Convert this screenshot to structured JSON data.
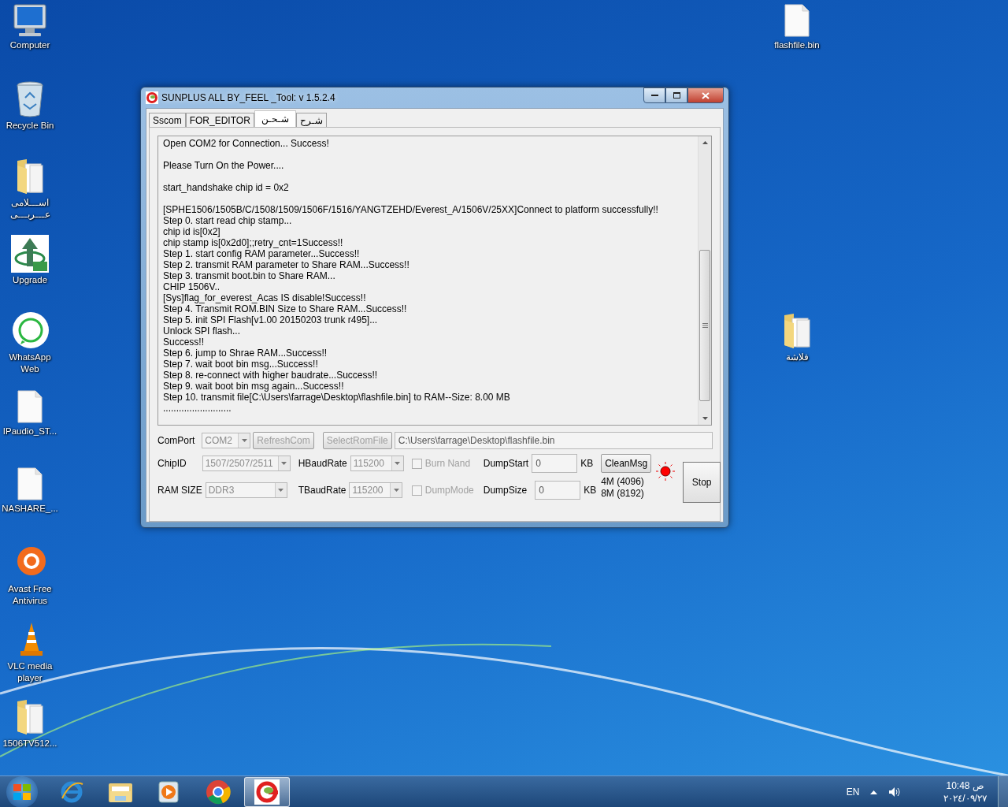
{
  "desktop_left": [
    {
      "label": "Computer",
      "kind": "computer"
    },
    {
      "label": "Recycle Bin",
      "kind": "recycle"
    },
    {
      "label": "اســـلامى عـــربـــى",
      "kind": "folder"
    },
    {
      "label": "Upgrade",
      "kind": "upgrade"
    },
    {
      "label": "WhatsApp Web",
      "kind": "whatsapp"
    },
    {
      "label": "IPaudio_ST...",
      "kind": "file"
    },
    {
      "label": "NASHARE_...",
      "kind": "file"
    },
    {
      "label": "Avast Free Antivirus",
      "kind": "avast"
    },
    {
      "label": "VLC media player",
      "kind": "vlc"
    },
    {
      "label": "1506TV512...",
      "kind": "folder"
    }
  ],
  "desktop_right": [
    {
      "label": "flashfile.bin",
      "kind": "file"
    },
    {
      "label": "فلاشة",
      "kind": "folder"
    }
  ],
  "window": {
    "title": "SUNPLUS ALL BY_FEEL _Tool: v 1.5.2.4",
    "tabs": [
      {
        "label": "Sscom",
        "selected": false
      },
      {
        "label": "FOR_EDITOR",
        "selected": false
      },
      {
        "label": "شـحـن",
        "selected": true
      },
      {
        "label": "شـرح",
        "selected": false
      }
    ],
    "log_blocks": [
      {
        "lines": [
          "Open COM2 for Connection... Success!"
        ]
      },
      {
        "lines": [
          "Please Turn On the Power...."
        ]
      },
      {
        "lines": [
          "start_handshake chip id = 0x2"
        ]
      },
      {
        "lines": [
          "[SPHE1506/1505B/C/1508/1509/1506F/1516/YANGTZEHD/Everest_A/1506V/25XX]Connect to platform successfully!!",
          "Step 0. start read chip stamp...",
          "chip id is[0x2]",
          "chip stamp is[0x2d0];;retry_cnt=1Success!!",
          "Step 1. start config RAM parameter...Success!!",
          "Step 2. transmit RAM parameter to Share RAM...Success!!",
          "Step 3. transmit boot.bin to Share RAM...",
          "CHIP 1506V..",
          "[Sys]flag_for_everest_Acas IS disable!Success!!",
          "Step 4.  Transmit ROM.BIN Size to Share RAM...Success!!",
          "Step 5. init SPI Flash[v1.00 20150203 trunk r495]...",
          "Unlock SPI flash...",
          "Success!!",
          "Step 6. jump to Shrae RAM...Success!!",
          "Step 7. wait boot bin msg...Success!!",
          "Step 8. re-connect with higher baudrate...Success!!",
          "Step 9. wait boot bin msg again...Success!!",
          "Step 10. transmit file[C:\\Users\\farrage\\Desktop\\flashfile.bin] to RAM--Size: 8.00 MB",
          ".........................."
        ]
      }
    ],
    "comport": {
      "label": "ComPort",
      "value": "COM2",
      "disabled": true
    },
    "refresh_button": {
      "label": "RefreshCom",
      "disabled": true
    },
    "select_rom_button": {
      "label": "SelectRomFile",
      "disabled": true
    },
    "rom_path": {
      "value": "C:\\Users\\farrage\\Desktop\\flashfile.bin"
    },
    "chip_id": {
      "label": "ChipID",
      "value": "1507/2507/2511",
      "disabled": true
    },
    "ram_size": {
      "label": "RAM SIZE",
      "value": "DDR3",
      "disabled": true
    },
    "hbaudrate": {
      "label": "HBaudRate",
      "value": "115200",
      "disabled": true
    },
    "tbaudrate": {
      "label": "TBaudRate",
      "value": "115200",
      "disabled": true
    },
    "burn_nand": {
      "label": "Burn Nand",
      "checked": false,
      "disabled": true
    },
    "dump_mode": {
      "label": "DumpMode",
      "checked": false,
      "disabled": true
    },
    "dump_start": {
      "label": "DumpStart",
      "value": "0",
      "unit": "KB"
    },
    "dump_size": {
      "label": "DumpSize",
      "value": "0",
      "unit": "KB"
    },
    "clean_button": {
      "label": "CleanMsg"
    },
    "size_hints": [
      "4M (4096)",
      "8M (8192)"
    ],
    "status_led": {
      "on": true
    },
    "stop_button": {
      "label": "Stop"
    }
  },
  "taskbar": {
    "apps": [
      {
        "kind": "ie",
        "selected": false
      },
      {
        "kind": "explorer",
        "selected": false
      },
      {
        "kind": "media",
        "selected": false
      },
      {
        "kind": "chrome",
        "selected": false
      },
      {
        "kind": "tool",
        "selected": true
      }
    ],
    "language": "EN",
    "time": "10:48 ص",
    "date": "٢٠٢٤/٠٩/٢٧"
  }
}
